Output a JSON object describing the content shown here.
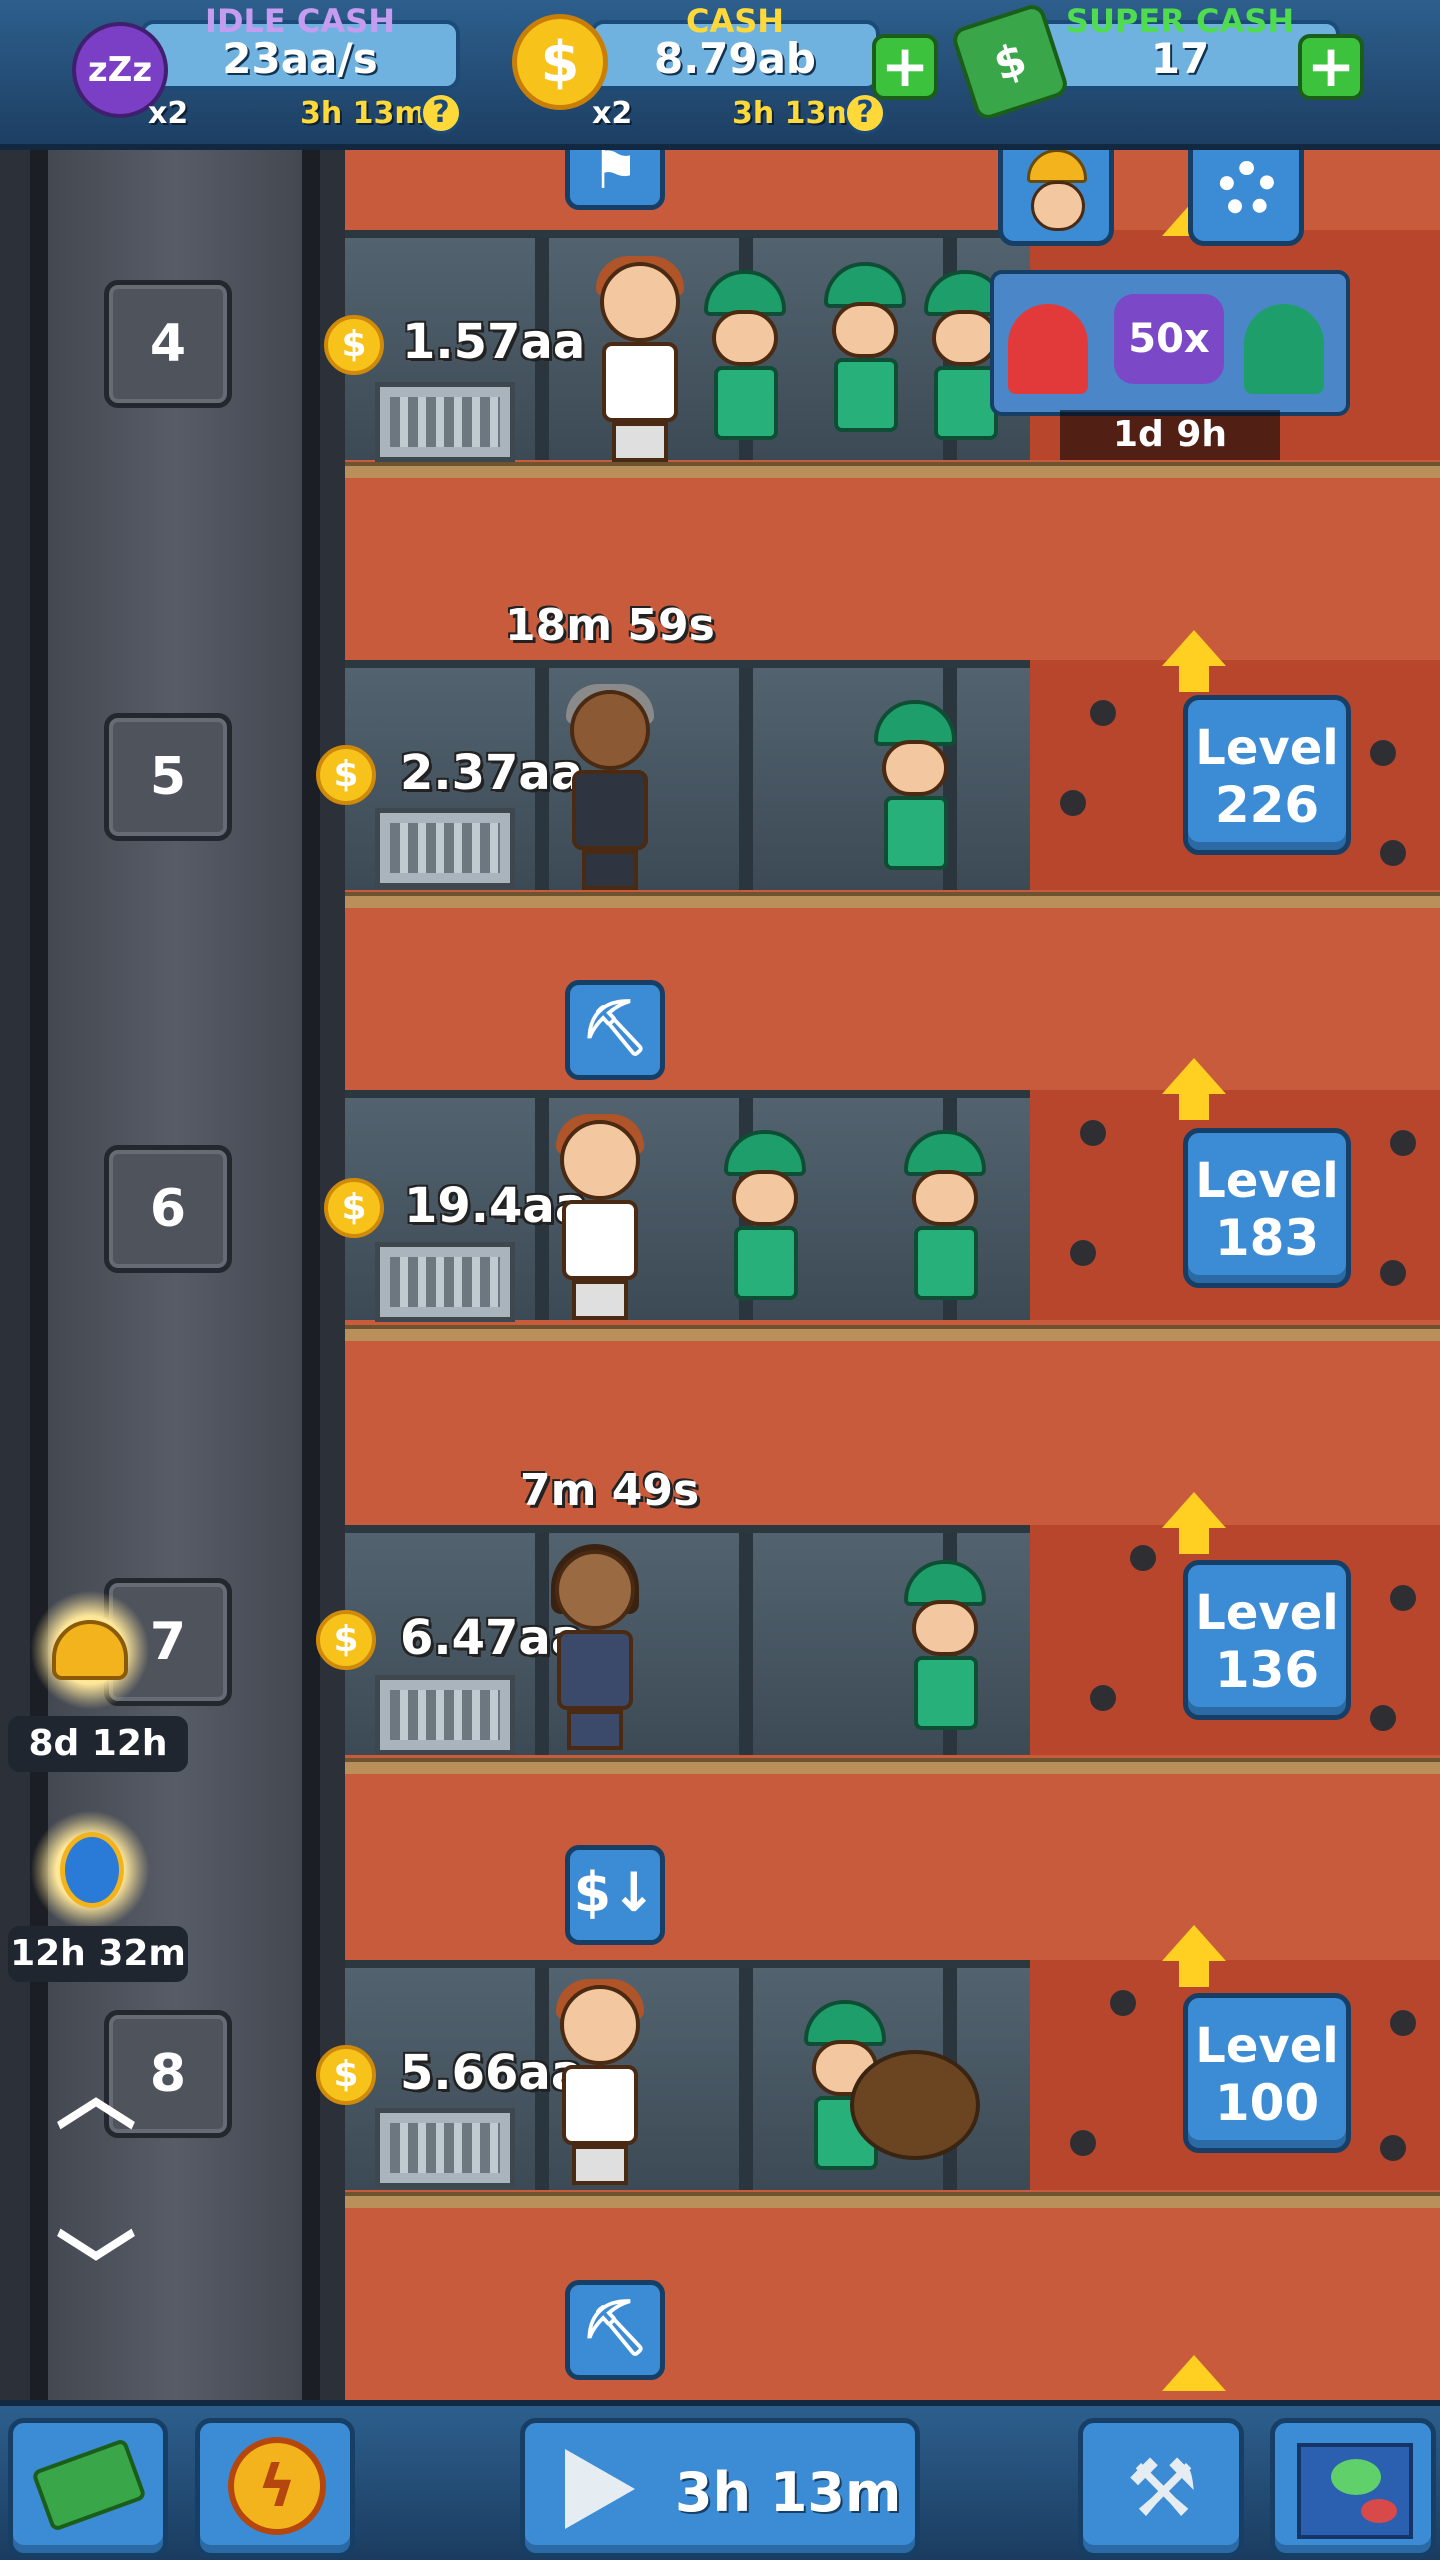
{
  "topbar": {
    "idle_cash": {
      "label": "IDLE CASH",
      "value": "23aa/s",
      "multiplier": "x2",
      "timer": "3h 13m",
      "color": "#c59cf0"
    },
    "cash": {
      "label": "CASH",
      "value": "8.79ab",
      "multiplier": "x2",
      "timer": "3h 13m",
      "color": "#ffd93a"
    },
    "super_cash": {
      "label": "SUPER CASH",
      "value": "17",
      "color": "#4fdc4f"
    },
    "help_glyph": "?",
    "plus_glyph": "+"
  },
  "corner": {
    "manager_icon": "miner-face-icon",
    "settings_icon": "gear-icon"
  },
  "promo": {
    "badge": "50x",
    "timer": "1d 9h"
  },
  "shafts": [
    {
      "number": "4",
      "amount": "1.57aa"
    },
    {
      "number": "5",
      "amount": "2.37aa",
      "timer": "18m 59s",
      "level_word": "Level",
      "level": "226"
    },
    {
      "number": "6",
      "amount": "19.4aa",
      "level_word": "Level",
      "level": "183"
    },
    {
      "number": "7",
      "amount": "6.47aa",
      "timer": "7m 49s",
      "level_word": "Level",
      "level": "136"
    },
    {
      "number": "8",
      "amount": "5.66aa",
      "level_word": "Level",
      "level": "100"
    }
  ],
  "coin_glyph": "$",
  "events": [
    {
      "name": "christmas-bells",
      "timer": "8d 12h"
    },
    {
      "name": "hourglass-boost",
      "timer": "12h 32m"
    }
  ],
  "nav": {
    "up": "︿",
    "down": "﹀"
  },
  "bottombar": {
    "boost_timer": "3h 13m"
  }
}
